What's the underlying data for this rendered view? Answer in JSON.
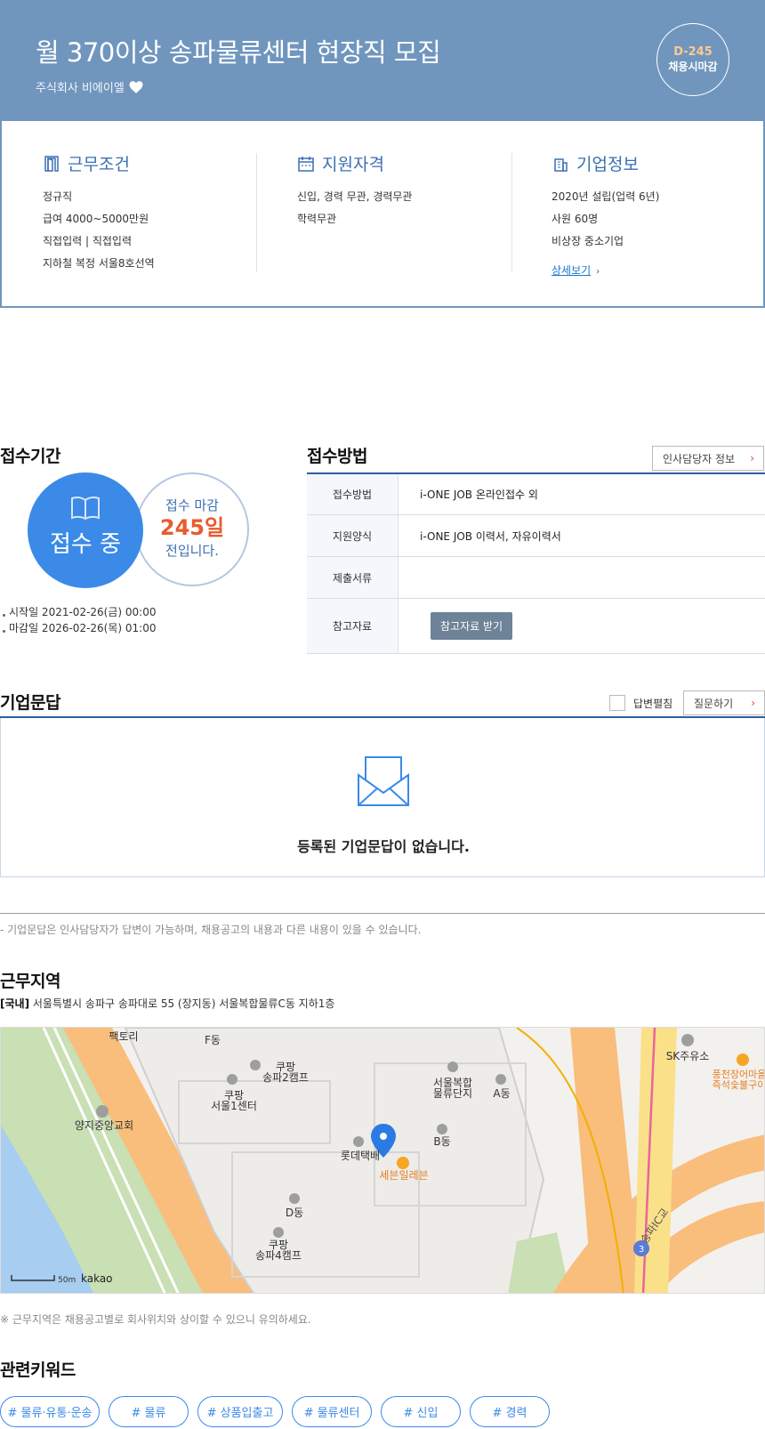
{
  "header": {
    "title": "월 370이상 송파물류센터 현장직 모집",
    "company": "주식회사 비에이엘",
    "dday": "D-245",
    "deadline_type": "채용시마감",
    "colors": {
      "banner": "#7096be",
      "dday": "#ffc894"
    }
  },
  "summary": {
    "work": {
      "title": "근무조건",
      "lines": [
        "정규직",
        "급여 4000~5000만원",
        "직접입력 | 직접입력",
        "지하철 복정 서울8호선역"
      ]
    },
    "qual": {
      "title": "지원자격",
      "lines": [
        "신입, 경력 무관, 경력무관",
        "학력무관"
      ]
    },
    "corp": {
      "title": "기업정보",
      "lines": [
        "2020년 설립(업력 6년)",
        "사원 60명",
        "비상장 중소기업"
      ],
      "link": "상세보기"
    }
  },
  "period": {
    "title": "접수기간",
    "status": "접수 중",
    "remain_prefix": "접수 마감",
    "remain_days": "245일",
    "remain_suffix": "전입니다.",
    "start": "시작일 2021-02-26(금) 00:00",
    "end": "마감일 2026-02-26(목) 01:00",
    "colors": {
      "active": "#3b8ae7",
      "days": "#ea5a2f"
    }
  },
  "method": {
    "title": "접수방법",
    "hr_button": "인사담당자 정보",
    "rows": [
      {
        "label": "접수방법",
        "value": "i-ONE JOB 온라인접수 외"
      },
      {
        "label": "지원양식",
        "value": "i-ONE JOB 이력서, 자유이력서"
      },
      {
        "label": "제출서류",
        "value": ""
      },
      {
        "label": "참고자료",
        "button": "참고자료 받기"
      }
    ]
  },
  "qa": {
    "title": "기업문답",
    "toggle_label": "답변펼침",
    "ask_button": "질문하기",
    "empty": "등록된 기업문답이 없습니다.",
    "note": "- 기업문답은 인사담당자가 답변이 가능하며, 채용공고의 내용과 다른 내용이 있을 수 있습니다."
  },
  "location": {
    "title": "근무지역",
    "region": "[국내]",
    "address": "서울특별시 송파구 송파대로 55 (장지동) 서울복합물류C동 지하1층",
    "map_labels": [
      "팩토리",
      "F동",
      "쿠팡 송파2캠프",
      "쿠팡 서울1센터",
      "양지중앙교회",
      "서울복합 물류단지",
      "A동",
      "B동",
      "롯데택배",
      "세븐일레븐",
      "D동",
      "쿠팡 송파4캠프",
      "SK주유소",
      "풍천장어마을 즉석숯불구이",
      "송파IC교",
      "3"
    ],
    "scale": "50m",
    "brand": "kakao",
    "note": "※ 근무지역은 채용공고별로 회사위치와 상이할 수 있으니 유의하세요."
  },
  "keywords": {
    "title": "관련키워드",
    "items": [
      "# 물류·유통·운송",
      "# 물류",
      "# 상품입출고",
      "# 물류센터",
      "# 신입",
      "# 경력"
    ]
  }
}
